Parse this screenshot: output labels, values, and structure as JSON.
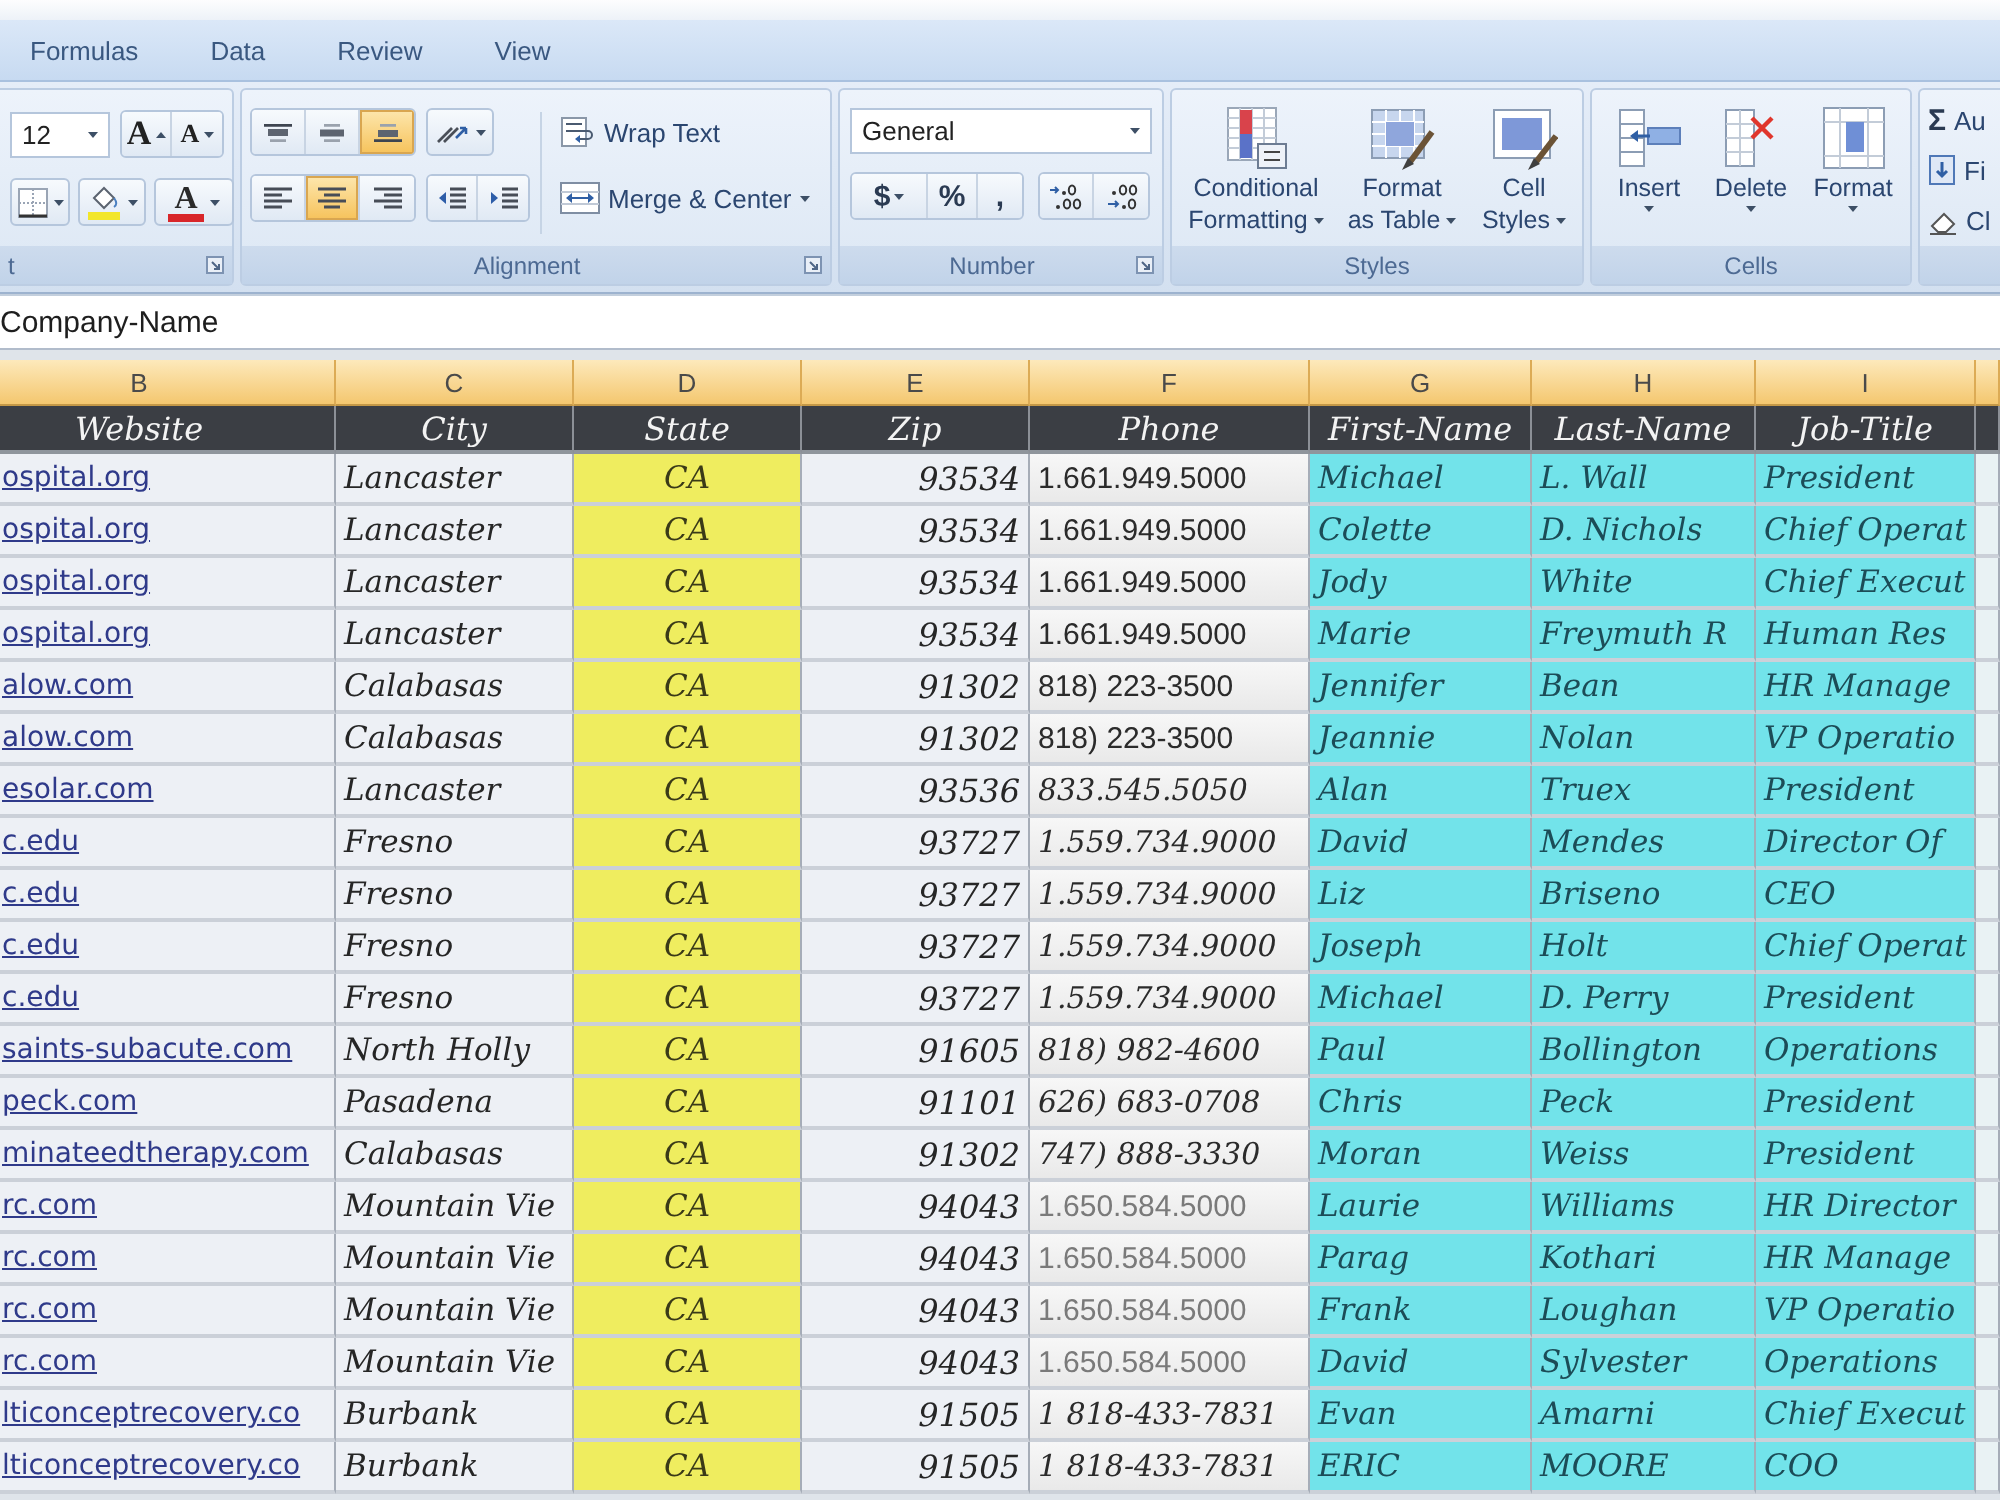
{
  "tabs": [
    {
      "label": "Formulas",
      "selected": false
    },
    {
      "label": "Data",
      "selected": false
    },
    {
      "label": "Review",
      "selected": false
    },
    {
      "label": "View",
      "selected": false
    }
  ],
  "ribbon": {
    "font": {
      "label": "t",
      "size": "12",
      "grow": "A",
      "shrink": "A",
      "font_color": "A"
    },
    "alignment": {
      "label": "Alignment",
      "vertical": [
        {
          "kind": "top",
          "selected": false
        },
        {
          "kind": "middle",
          "selected": false
        },
        {
          "kind": "bottom",
          "selected": true
        }
      ],
      "horizontal": [
        {
          "kind": "left",
          "selected": false
        },
        {
          "kind": "center",
          "selected": true
        },
        {
          "kind": "right",
          "selected": false
        }
      ],
      "wrap_text": "Wrap Text",
      "merge": "Merge & Center"
    },
    "number": {
      "label": "Number",
      "format": "General",
      "currency": "$",
      "percent": "%",
      "comma": ","
    },
    "styles": {
      "label": "Styles",
      "buttons": [
        {
          "kind": "conditional",
          "lines": [
            "Conditional",
            "Formatting"
          ]
        },
        {
          "kind": "table",
          "lines": [
            "Format",
            "as Table"
          ]
        },
        {
          "kind": "cell",
          "lines": [
            "Cell",
            "Styles"
          ]
        }
      ]
    },
    "cells": {
      "label": "Cells",
      "buttons": [
        {
          "kind": "insert",
          "label": "Insert"
        },
        {
          "kind": "delete",
          "label": "Delete"
        },
        {
          "kind": "format",
          "label": "Format"
        }
      ]
    },
    "editing": {
      "items": [
        {
          "kind": "autosum",
          "symbol": "Σ",
          "label": "Au"
        },
        {
          "kind": "fill",
          "label": "Fi"
        },
        {
          "kind": "clear",
          "label": "Cl"
        }
      ]
    }
  },
  "formula_bar": {
    "value": "Company-Name"
  },
  "sheet": {
    "columns": [
      {
        "letter": "B",
        "heading": "Website",
        "kind": "link",
        "selected": true
      },
      {
        "letter": "C",
        "heading": "City",
        "kind": "text",
        "selected": true
      },
      {
        "letter": "D",
        "heading": "State",
        "kind": "code",
        "selected": true,
        "color": "#efed5f"
      },
      {
        "letter": "E",
        "heading": "Zip",
        "kind": "number",
        "selected": true
      },
      {
        "letter": "F",
        "heading": "Phone",
        "kind": "phone",
        "selected": true
      },
      {
        "letter": "G",
        "heading": "First-Name",
        "kind": "name",
        "selected": true,
        "color": "#72e3ea"
      },
      {
        "letter": "H",
        "heading": "Last-Name",
        "kind": "name",
        "selected": true,
        "color": "#72e3ea"
      },
      {
        "letter": "I",
        "heading": "Job-Title",
        "kind": "name",
        "selected": true,
        "color": "#72e3ea"
      },
      {
        "kind": "blank",
        "selected": true
      }
    ],
    "rows": [
      {
        "kind": "sans",
        "cells": [
          "ospital.org",
          "Lancaster",
          "CA",
          "93534",
          "1.661.949.5000",
          "Michael",
          "L. Wall",
          "President"
        ]
      },
      {
        "kind": "sans",
        "cells": [
          "ospital.org",
          "Lancaster",
          "CA",
          "93534",
          "1.661.949.5000",
          "Colette",
          "D. Nichols",
          "Chief Operat"
        ]
      },
      {
        "kind": "sans",
        "cells": [
          "ospital.org",
          "Lancaster",
          "CA",
          "93534",
          "1.661.949.5000",
          "Jody",
          "White",
          "Chief Execut"
        ]
      },
      {
        "kind": "sans",
        "cells": [
          "ospital.org",
          "Lancaster",
          "CA",
          "93534",
          "1.661.949.5000",
          "Marie",
          "Freymuth R",
          "Human Res"
        ]
      },
      {
        "kind": "sans",
        "cells": [
          "alow.com",
          "Calabasas",
          "CA",
          "91302",
          "818) 223-3500",
          "Jennifer",
          "Bean",
          "HR Manage"
        ]
      },
      {
        "kind": "sans",
        "cells": [
          "alow.com",
          "Calabasas",
          "CA",
          "91302",
          "818) 223-3500",
          "Jeannie",
          "Nolan",
          "VP Operatio"
        ]
      },
      {
        "kind": "serif",
        "cells": [
          "esolar.com",
          "Lancaster",
          "CA",
          "93536",
          "833.545.5050",
          "Alan",
          "Truex",
          "President"
        ]
      },
      {
        "kind": "serif",
        "cells": [
          "c.edu",
          "Fresno",
          "CA",
          "93727",
          "1.559.734.9000",
          "David",
          "Mendes",
          "Director Of"
        ]
      },
      {
        "kind": "serif",
        "cells": [
          "c.edu",
          "Fresno",
          "CA",
          "93727",
          "1.559.734.9000",
          "Liz",
          "Briseno",
          "CEO"
        ]
      },
      {
        "kind": "serif",
        "cells": [
          "c.edu",
          "Fresno",
          "CA",
          "93727",
          "1.559.734.9000",
          "Joseph",
          "Holt",
          "Chief Operat"
        ]
      },
      {
        "kind": "serif",
        "cells": [
          "c.edu",
          "Fresno",
          "CA",
          "93727",
          "1.559.734.9000",
          "Michael",
          "D. Perry",
          "President"
        ]
      },
      {
        "kind": "serif",
        "cells": [
          "saints-subacute.com",
          "North Holly",
          "CA",
          "91605",
          "818) 982-4600",
          "Paul",
          "Bollington",
          "Operations"
        ]
      },
      {
        "kind": "serif",
        "cells": [
          "peck.com",
          "Pasadena",
          "CA",
          "91101",
          "626) 683-0708",
          "Chris",
          "Peck",
          "President"
        ]
      },
      {
        "kind": "serif",
        "cells": [
          "minateedtherapy.com",
          "Calabasas",
          "CA",
          "91302",
          "747) 888-3330",
          "Moran",
          "Weiss",
          "President"
        ]
      },
      {
        "kind": "faint",
        "cells": [
          "rc.com",
          "Mountain Vie",
          "CA",
          "94043",
          "1.650.584.5000",
          "Laurie",
          "Williams",
          "HR Director"
        ]
      },
      {
        "kind": "faint",
        "cells": [
          "rc.com",
          "Mountain Vie",
          "CA",
          "94043",
          "1.650.584.5000",
          "Parag",
          "Kothari",
          "HR Manage"
        ]
      },
      {
        "kind": "faint",
        "cells": [
          "rc.com",
          "Mountain Vie",
          "CA",
          "94043",
          "1.650.584.5000",
          "Frank",
          "Loughan",
          "VP Operatio"
        ]
      },
      {
        "kind": "faint",
        "cells": [
          "rc.com",
          "Mountain Vie",
          "CA",
          "94043",
          "1.650.584.5000",
          "David",
          "Sylvester",
          "Operations"
        ]
      },
      {
        "kind": "serif",
        "cells": [
          "lticonceptrecovery.co",
          "Burbank",
          "CA",
          "91505",
          "1 818-433-7831",
          "Evan",
          "Amarni",
          "Chief Execut"
        ]
      },
      {
        "kind": "serif",
        "cells": [
          "lticonceptrecovery.co",
          "Burbank",
          "CA",
          "91505",
          "1 818-433-7831",
          "ERIC",
          "MOORE",
          "COO"
        ]
      }
    ]
  }
}
